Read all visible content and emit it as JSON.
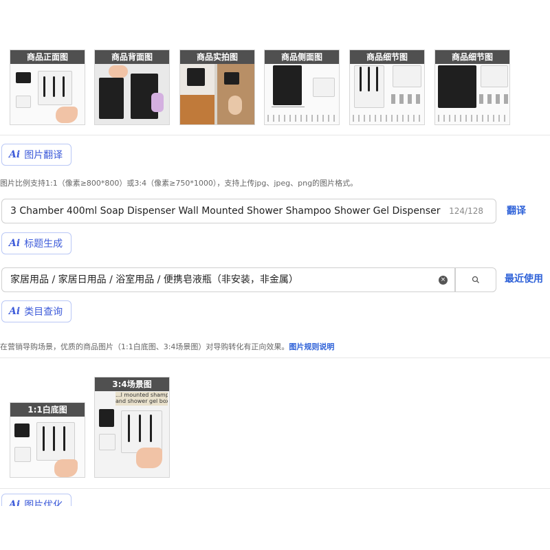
{
  "gallery": {
    "thumbnails": [
      {
        "label": "商品正面图"
      },
      {
        "label": "商品背面图"
      },
      {
        "label": "商品实拍图"
      },
      {
        "label": "商品侧面图"
      },
      {
        "label": "商品细节图"
      },
      {
        "label": "商品细节图"
      }
    ]
  },
  "translate_section": {
    "button_label": "图片翻译",
    "hint": "图片比例支持1:1（像素≥800*800）或3:4（像素≥750*1000），支持上传jpg、jpeg、png的图片格式。"
  },
  "title_section": {
    "value": "3 Chamber 400ml Soap Dispenser Wall Mounted Shower Shampoo Shower Gel Dispenser N",
    "counter": "124/128",
    "translate_link": "翻译",
    "button_label": "标题生成"
  },
  "category_section": {
    "value": "家居用品 / 家居日用品 / 浴室用品 / 便携皂液瓶（非安装，非金属）",
    "recent_link": "最近使用",
    "button_label": "类目查询"
  },
  "marketing_section": {
    "hint": "在营销导购场景，优质的商品图片（1:1白底图、3:4场景图）对导购转化有正向效果。",
    "rules_link": "图片规则说明",
    "square_label": "1:1白底图",
    "scene_label": "3:4场景图",
    "scene_caption_1": "...l mounted shampoo",
    "scene_caption_2": "and shower gel box"
  },
  "optimize_section": {
    "button_label": "图片优化"
  },
  "colors": {
    "accent": "#3d5bd9",
    "link": "#2f62d8",
    "label_bg": "#505050"
  }
}
